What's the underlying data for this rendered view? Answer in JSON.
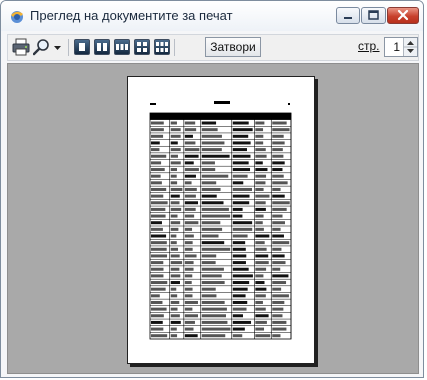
{
  "window": {
    "title": "Преглед на документите за печат",
    "controls": [
      "minimize-icon",
      "maximize-icon",
      "close-icon"
    ]
  },
  "toolbar": {
    "icons": [
      "printer-icon",
      "zoom-icon",
      "dropdown-arrow-icon",
      "one-page-icon",
      "two-pages-icon",
      "three-pages-icon",
      "four-pages-icon",
      "six-pages-icon"
    ],
    "close_label": "Затвори",
    "page_label": "стр.",
    "page_value": "1"
  },
  "preview": {
    "table_rows": 34,
    "table_columns": 8
  },
  "colors": {
    "accent": "#c8412d",
    "preview_background": "#a9a9a9"
  }
}
